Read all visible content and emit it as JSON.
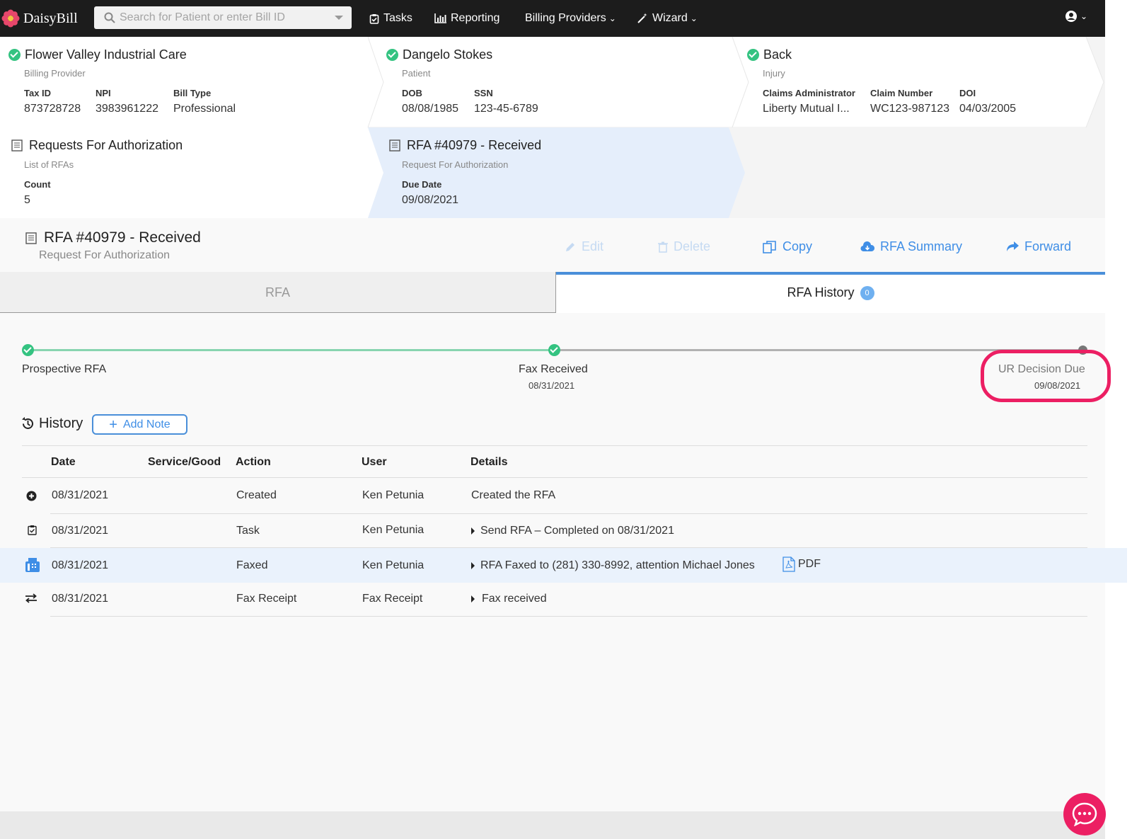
{
  "app": {
    "name": "DaisyBill"
  },
  "search": {
    "placeholder": "Search for Patient or enter Bill ID"
  },
  "nav": {
    "tasks": "Tasks",
    "reporting": "Reporting",
    "billing_providers": "Billing Providers",
    "wizard": "Wizard"
  },
  "provider": {
    "title": "Flower Valley Industrial Care",
    "subtitle": "Billing Provider",
    "fields": [
      {
        "label": "Tax ID",
        "value": "873728728"
      },
      {
        "label": "NPI",
        "value": "3983961222"
      },
      {
        "label": "Bill Type",
        "value": "Professional"
      }
    ]
  },
  "patient": {
    "title": "Dangelo Stokes",
    "subtitle": "Patient",
    "fields": [
      {
        "label": "DOB",
        "value": "08/08/1985"
      },
      {
        "label": "SSN",
        "value": "123-45-6789"
      }
    ]
  },
  "injury": {
    "title": "Back",
    "subtitle": "Injury",
    "fields": [
      {
        "label": "Claims Administrator",
        "value": "Liberty Mutual I..."
      },
      {
        "label": "Claim Number",
        "value": "WC123-987123"
      },
      {
        "label": "DOI",
        "value": "04/03/2005"
      }
    ]
  },
  "rfa_list": {
    "title": "Requests For Authorization",
    "subtitle": "List of RFAs",
    "count_label": "Count",
    "count_value": "5"
  },
  "rfa_card": {
    "title": "RFA #40979 - Received",
    "subtitle": "Request For Authorization",
    "due_label": "Due Date",
    "due_value": "09/08/2021"
  },
  "rfa_header": {
    "title": "RFA #40979 - Received",
    "subtitle": "Request For Authorization",
    "actions": {
      "edit": "Edit",
      "delete": "Delete",
      "copy": "Copy",
      "summary": "RFA Summary",
      "forward": "Forward"
    }
  },
  "tabs": {
    "rfa": "RFA",
    "history": "RFA History",
    "history_badge": "0"
  },
  "progress": {
    "steps": [
      {
        "label": "Prospective RFA",
        "date": ""
      },
      {
        "label": "Fax Received",
        "date": "08/31/2021"
      },
      {
        "label": "UR Decision Due",
        "date": "09/08/2021"
      }
    ],
    "completed_fraction": 0.5
  },
  "history": {
    "title": "History",
    "add_note": "Add Note",
    "columns": [
      "Date",
      "Service/Good",
      "Action",
      "User",
      "Details"
    ],
    "rows": [
      {
        "icon": "plus-circle-icon",
        "date": "08/31/2021",
        "service": "",
        "action": "Created",
        "user": "Ken Petunia",
        "details": "Created the RFA",
        "expandable": false,
        "attachment": ""
      },
      {
        "icon": "clipboard-check-icon",
        "date": "08/31/2021",
        "service": "",
        "action": "Task",
        "user": "Ken Petunia",
        "details": "Send RFA – Completed on 08/31/2021",
        "expandable": true,
        "attachment": ""
      },
      {
        "icon": "fax-icon",
        "date": "08/31/2021",
        "service": "",
        "action": "Faxed",
        "user": "Ken Petunia",
        "details": "RFA Faxed to (281) 330-8992, attention Michael Jones",
        "expandable": true,
        "attachment": "PDF"
      },
      {
        "icon": "exchange-icon",
        "date": "08/31/2021",
        "service": "",
        "action": "Fax Receipt",
        "user": "Fax Receipt",
        "details": "Fax received",
        "expandable": true,
        "attachment": ""
      }
    ]
  },
  "colors": {
    "accent": "#3f8ee6",
    "success": "#34c381",
    "highlight": "#ec1f63",
    "topbar": "#1c1c1c"
  }
}
